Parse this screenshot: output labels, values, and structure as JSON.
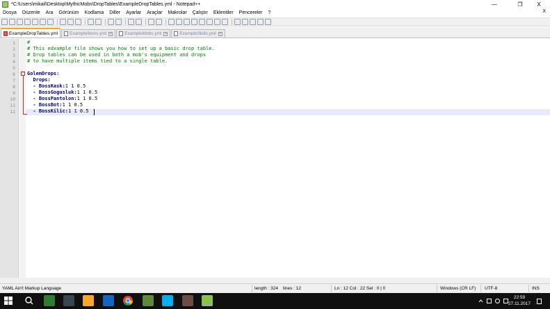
{
  "window": {
    "title": "*C:\\Users\\mikail\\Desktop\\MythicMobs\\DropTables\\ExampleDropTables.yml - Notepad++",
    "minimize": "—",
    "maximize": "❐",
    "close": "X"
  },
  "menu": {
    "items": [
      "Dosya",
      "Düzenle",
      "Ara",
      "Görünüm",
      "Kodlama",
      "Diller",
      "Ayarlar",
      "Araçlar",
      "Makrolar",
      "Çalıştır",
      "Eklentiler",
      "Pencereler",
      "?"
    ],
    "close_doc": "X"
  },
  "tabs": [
    {
      "label": "ExampleDropTables.yml",
      "active": true
    },
    {
      "label": "ExampleItems.yml",
      "active": false
    },
    {
      "label": "ExampleMobs.yml",
      "active": false
    },
    {
      "label": "ExampleSkills.yml",
      "active": false
    }
  ],
  "editor": {
    "line_numbers": [
      "1",
      "2",
      "3",
      "4",
      "5",
      "6",
      "7",
      "8",
      "9",
      "10",
      "11",
      "12"
    ],
    "lines": [
      {
        "type": "comment",
        "text": "#"
      },
      {
        "type": "comment",
        "text": "# This edxample file shows you how to set up a basic drop table."
      },
      {
        "type": "comment",
        "text": "# Drop tables can be used in both a mob's equipment and drops"
      },
      {
        "type": "comment",
        "text": "# to have multiple items tied to a single table."
      },
      {
        "type": "blank",
        "text": ""
      },
      {
        "type": "key",
        "key": "GolemDrops:",
        "value": ""
      },
      {
        "type": "key",
        "key": "  Drops:",
        "value": ""
      },
      {
        "type": "key",
        "key": "  - BossKask:",
        "value": "1 1 0.5"
      },
      {
        "type": "key",
        "key": "  - BossGogusluk:",
        "value": "1 1 0.5"
      },
      {
        "type": "key",
        "key": "  - BossPantolon:",
        "value": "1 1 0.5"
      },
      {
        "type": "key",
        "key": "  - BossBot:",
        "value": "1 1 0.5"
      },
      {
        "type": "key",
        "key": "  - BossKilic:",
        "value": "1 1 0.5"
      }
    ]
  },
  "status": {
    "language": "YAML Ain't Markup Language",
    "length": "length : 324",
    "lines": "lines : 12",
    "position": "Ln : 12    Col : 22    Sel : 0 | 0",
    "eol": "Windows (CR LF)",
    "encoding": "UTF-8",
    "mode": "INS"
  },
  "taskbar": {
    "time": "22:59",
    "date": "27.11.2017"
  }
}
